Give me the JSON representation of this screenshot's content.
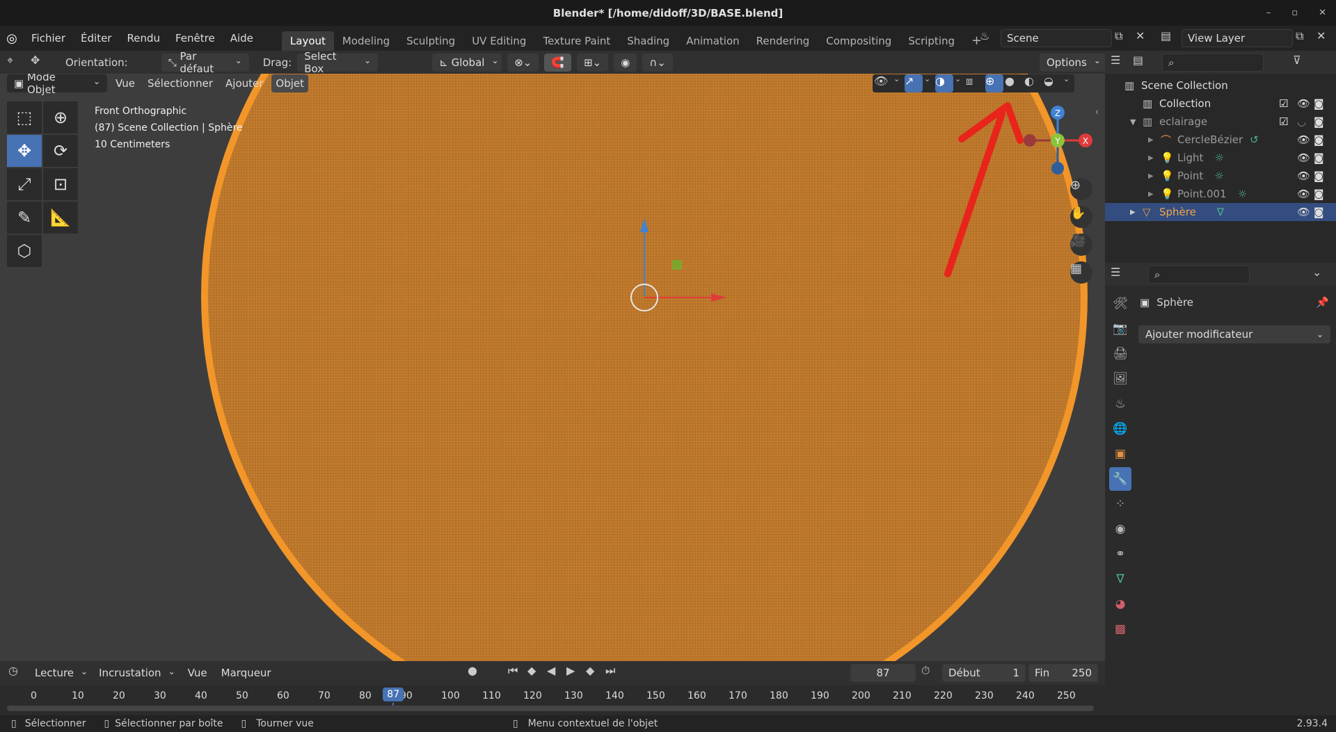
{
  "window": {
    "title": "Blender* [/home/didoff/3D/BASE.blend]",
    "version": "2.93.4"
  },
  "menubar": {
    "menus": [
      "Fichier",
      "Éditer",
      "Rendu",
      "Fenêtre",
      "Aide"
    ],
    "workspaces": [
      "Layout",
      "Modeling",
      "Sculpting",
      "UV Editing",
      "Texture Paint",
      "Shading",
      "Animation",
      "Rendering",
      "Compositing",
      "Scripting"
    ],
    "active_workspace": "Layout",
    "scene": "Scene",
    "view_layer": "View Layer"
  },
  "tool_header": {
    "orientation_label": "Orientation:",
    "orientation_value": "Par défaut",
    "drag_label": "Drag:",
    "drag_value": "Select Box",
    "transform_orientation": "Global",
    "options": "Options"
  },
  "viewport_header": {
    "mode": "Mode Objet",
    "menus": [
      "Vue",
      "Sélectionner",
      "Ajouter",
      "Objet"
    ]
  },
  "viewport": {
    "view_name": "Front Orthographic",
    "collection_info": "(87) Scene Collection | Sphère",
    "scale_info": "10 Centimeters",
    "gizmo": {
      "z": "Z",
      "y": "Y",
      "x": "X"
    },
    "colors": {
      "background": "#3d3d3d",
      "sphere": "#f2962a",
      "selection": "#4772b3",
      "annotation": "#e8241b"
    }
  },
  "outliner": {
    "root": "Scene Collection",
    "items": [
      {
        "name": "Collection",
        "level": 1
      },
      {
        "name": "eclairage",
        "level": 1
      },
      {
        "name": "CercleBézier",
        "level": 2
      },
      {
        "name": "Light",
        "level": 2
      },
      {
        "name": "Point",
        "level": 2
      },
      {
        "name": "Point.001",
        "level": 2
      },
      {
        "name": "Sphère",
        "level": 1,
        "selected": true
      }
    ]
  },
  "properties": {
    "object_name": "Sphère",
    "add_modifier": "Ajouter modificateur"
  },
  "timeline": {
    "menus": [
      "Lecture",
      "Incrustation",
      "Vue",
      "Marqueur"
    ],
    "current_frame": "87",
    "start_label": "Début",
    "start_value": "1",
    "end_label": "Fin",
    "end_value": "250",
    "ticks": [
      "0",
      "10",
      "20",
      "30",
      "40",
      "50",
      "60",
      "70",
      "80",
      "90",
      "100",
      "110",
      "120",
      "130",
      "140",
      "150",
      "160",
      "170",
      "180",
      "190",
      "200",
      "210",
      "220",
      "230",
      "240",
      "250"
    ]
  },
  "statusbar": {
    "items": [
      "Sélectionner",
      "Sélectionner par boîte",
      "Tourner vue",
      "Menu contextuel de l'objet"
    ]
  }
}
